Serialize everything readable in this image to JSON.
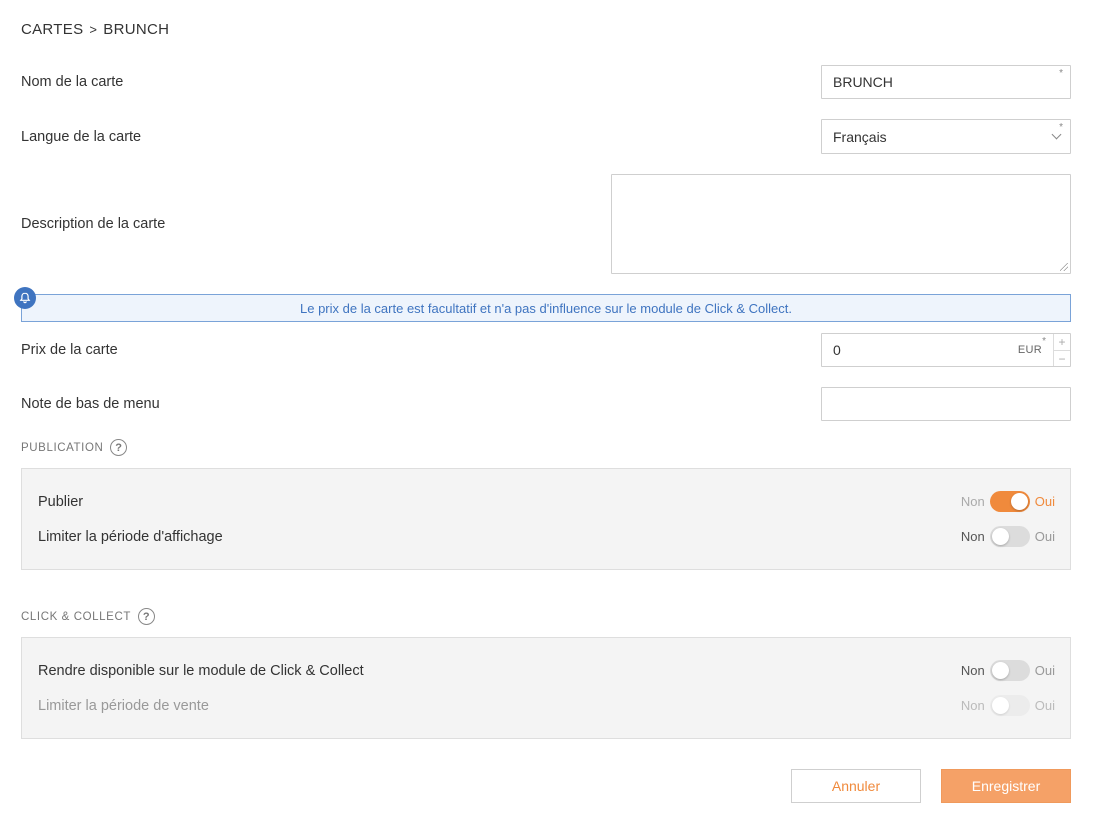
{
  "breadcrumb": {
    "parent": "CARTES",
    "separator": ">",
    "current": "BRUNCH"
  },
  "form": {
    "name": {
      "label": "Nom de la carte",
      "value": "BRUNCH",
      "required_mark": "*"
    },
    "language": {
      "label": "Langue de la carte",
      "value": "Français",
      "required_mark": "*"
    },
    "description": {
      "label": "Description de la carte",
      "value": ""
    },
    "info": {
      "text": "Le prix de la carte est facultatif et n'a pas d'influence sur le module de Click & Collect."
    },
    "price": {
      "label": "Prix de la carte",
      "value": "0",
      "unit": "EUR",
      "required_mark": "*",
      "plus": "+",
      "minus": "−"
    },
    "footer_note": {
      "label": "Note de bas de menu",
      "value": ""
    }
  },
  "publication": {
    "title": "PUBLICATION",
    "help": "?",
    "rows": [
      {
        "label": "Publier",
        "off_label": "Non",
        "on_label": "Oui",
        "state": "on"
      },
      {
        "label": "Limiter la période d'affichage",
        "off_label": "Non",
        "on_label": "Oui",
        "state": "off"
      }
    ]
  },
  "click_collect": {
    "title": "CLICK & COLLECT",
    "help": "?",
    "rows": [
      {
        "label": "Rendre disponible sur le module de Click & Collect",
        "off_label": "Non",
        "on_label": "Oui",
        "state": "off"
      },
      {
        "label": "Limiter la période de vente",
        "off_label": "Non",
        "on_label": "Oui",
        "state": "disabled"
      }
    ]
  },
  "actions": {
    "cancel": "Annuler",
    "save": "Enregistrer"
  },
  "colors": {
    "accent": "#f08a3c",
    "info": "#3f74c0"
  }
}
